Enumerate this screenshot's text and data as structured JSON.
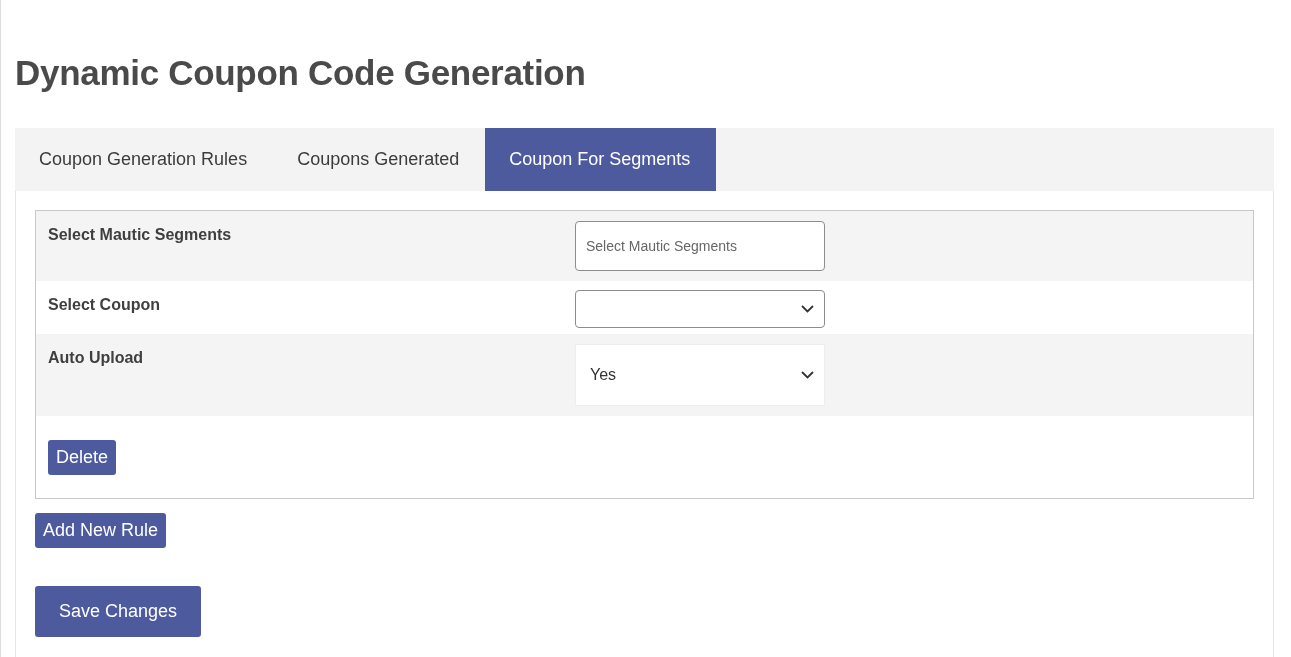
{
  "title": "Dynamic Coupon Code Generation",
  "tabs": [
    {
      "label": "Coupon Generation Rules",
      "selected": false
    },
    {
      "label": "Coupons Generated",
      "selected": false
    },
    {
      "label": "Coupon For Segments",
      "selected": true
    }
  ],
  "rule": {
    "fields": [
      {
        "kind": "text",
        "label": "Select Mautic Segments",
        "placeholder": "Select Mautic Segments"
      },
      {
        "kind": "select",
        "label": "Select Coupon"
      },
      {
        "kind": "plain-select",
        "label": "Auto Upload",
        "value": "Yes"
      }
    ],
    "delete_button": "Delete"
  },
  "add_button": "Add New Rule",
  "save_button": "Save Changes"
}
